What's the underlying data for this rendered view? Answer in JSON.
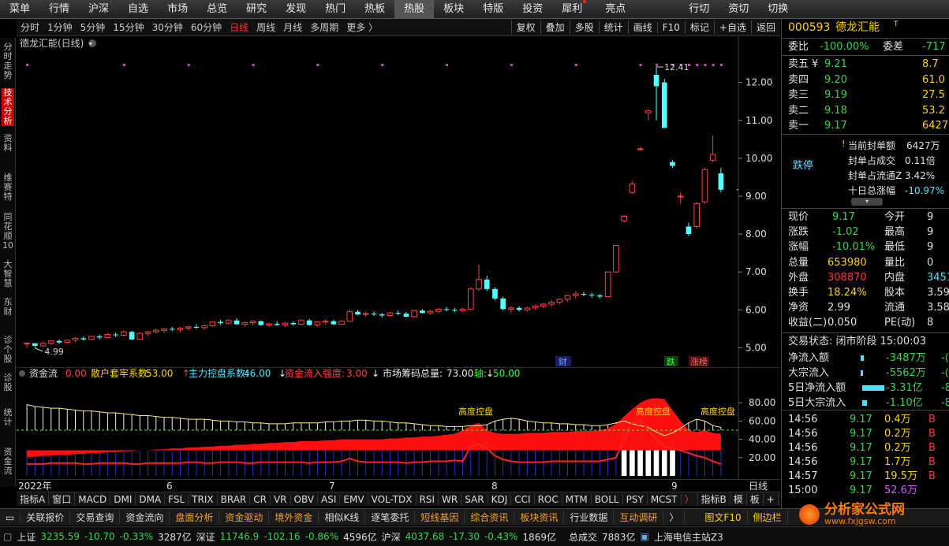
{
  "topmenu": [
    "菜单",
    "行情",
    "沪深",
    "自选",
    "市场",
    "总览",
    "研究",
    "发现",
    "热门",
    "热板",
    "热股",
    "板块",
    "特版",
    "投资",
    "犀利",
    "亮点",
    "行切",
    "资切",
    "切换"
  ],
  "topmenu_active": "热股",
  "sidebar": [
    "分时走势",
    "技术分析",
    "资料",
    "维赛特",
    "同花顺10",
    "大智慧",
    "东财",
    "诊个股",
    "诊股",
    "统计",
    "资金流"
  ],
  "sidebar_active": "技术分析",
  "periods": [
    "分时",
    "1分钟",
    "5分钟",
    "15分钟",
    "30分钟",
    "60分钟",
    "日线",
    "周线",
    "月线",
    "多周期",
    "更多 〉"
  ],
  "period_active": "日线",
  "toolbar": [
    "复权",
    "叠加",
    "多股",
    "统计",
    "画线",
    "F10",
    "标记",
    "+自选",
    "返回"
  ],
  "chart_title": "德龙汇能(日线)",
  "price_axis": [
    "12.00",
    "11.00",
    "10.00",
    "9.00",
    "8.00",
    "7.00",
    "6.00",
    "5.00"
  ],
  "high_label": "12.41",
  "low_label": "4.99",
  "markers": {
    "cai": "财",
    "die": "跌",
    "zhangbang": "涨榜"
  },
  "indicator_header": {
    "name": "资金流",
    "v0": "0.00",
    "s1_label": "散户套牢系数:",
    "s1": "53.00",
    "s2_label": "主力控盘系数:",
    "s2": "46.00",
    "s3_label": "资金流入强度:",
    "s3": "3.00",
    "s4_label": "市场筹码总量:",
    "s4": "73.00",
    "s5_label": "轴:",
    "s5": "50.00"
  },
  "ind_axis": [
    "80.00",
    "60.00",
    "40.00",
    "20.00"
  ],
  "ind_annotations": [
    "高度控盘",
    "高度控盘",
    "高度控盘"
  ],
  "xaxis": [
    "2022年",
    "6",
    "7",
    "8",
    "9"
  ],
  "xaxis_right": "日线",
  "indtabs": [
    "指标A",
    "窗口",
    "MACD",
    "DMI",
    "DMA",
    "FSL",
    "TRIX",
    "BRAR",
    "CR",
    "VR",
    "OBV",
    "ASI",
    "EMV",
    "VOL-TDX",
    "RSI",
    "WR",
    "SAR",
    "KDJ",
    "CCI",
    "ROC",
    "MTM",
    "BOLL",
    "PSY",
    "MCST",
    "〉"
  ],
  "indtabs_right": [
    "指标B",
    "模",
    "板",
    "+",
    "−"
  ],
  "funcbar": [
    "关联报价",
    "交易查询",
    "资金流向",
    "盘面分析",
    "资金驱动",
    "境外资金",
    "相似K线",
    "逐笔委托",
    "短线基因",
    "综合资讯",
    "板块资讯",
    "行业数据",
    "互动调研",
    "〉",
    "图文F10",
    "侧边栏"
  ],
  "funcbar_orange": [
    "盘面分析",
    "资金驱动",
    "境外资金",
    "短线基因",
    "综合资讯",
    "板块资讯",
    "互动调研"
  ],
  "status": {
    "sh_label": "上证",
    "sh_val": "3235.59",
    "sh_chg": "-10.70",
    "sh_pct": "-0.33%",
    "sh_amt": "3287亿",
    "sz_label": "深证",
    "sz_val": "11746.9",
    "sz_chg": "-102.16",
    "sz_pct": "-0.86%",
    "sz_amt": "4596亿",
    "hs_label": "沪深",
    "hs_val": "4037.68",
    "hs_chg": "-17.30",
    "hs_pct": "-0.43%",
    "hs_amt": "1869亿",
    "total_label": "总成交",
    "total_val": "7883亿",
    "server": "上海电信主站Z3"
  },
  "quote": {
    "code": "000593",
    "name": "德龙汇能",
    "weibi_label": "委比",
    "weibi": "-100.00%",
    "weicha_label": "委差",
    "weicha": "-717",
    "asks": [
      {
        "label": "卖五",
        "price": "9.21",
        "vol": "8.7"
      },
      {
        "label": "卖四",
        "price": "9.20",
        "vol": "61.0"
      },
      {
        "label": "卖三",
        "price": "9.19",
        "vol": "27.5"
      },
      {
        "label": "卖二",
        "price": "9.18",
        "vol": "53.2"
      },
      {
        "label": "卖一",
        "price": "9.17",
        "vol": "6427"
      }
    ],
    "limit_status": "跌停",
    "seal_info": [
      {
        "label": "当前封单额",
        "value": "6427万"
      },
      {
        "label": "封单占成交",
        "value": "0.11倍"
      },
      {
        "label": "封单占流通Z",
        "value": "3.42%"
      },
      {
        "label": "十日总涨幅",
        "value": "-10.97%"
      }
    ],
    "stats": [
      {
        "l1": "现价",
        "v1": "9.17",
        "l2": "今开",
        "v2": "9"
      },
      {
        "l1": "涨跌",
        "v1": "-1.02",
        "l2": "最高",
        "v2": "9"
      },
      {
        "l1": "涨幅",
        "v1": "-10.01%",
        "l2": "最低",
        "v2": "9"
      },
      {
        "l1": "总量",
        "v1": "653980",
        "l2": "量比",
        "v2": "0"
      },
      {
        "l1": "外盘",
        "v1": "308870",
        "l2": "内盘",
        "v2": "3451"
      },
      {
        "l1": "换手",
        "v1": "18.24%",
        "l2": "股本",
        "v2": "3.59"
      },
      {
        "l1": "净资",
        "v1": "2.99",
        "l2": "流通",
        "v2": "3.58"
      },
      {
        "l1": "收益(二)",
        "v1": "0.050",
        "l2": "PE(动)",
        "v2": "8"
      }
    ],
    "trade_status": "交易状态: 闭市阶段 15:00:03",
    "flows": [
      {
        "label": "净流入额",
        "value": "-3487万",
        "extra": "-("
      },
      {
        "label": "大宗流入",
        "value": "-5562万",
        "extra": "-("
      },
      {
        "label": "5日净流入额",
        "value": "-3.31亿",
        "extra": "-8"
      },
      {
        "label": "5日大宗流入",
        "value": "-1.10亿",
        "extra": "-8"
      }
    ],
    "ticks": [
      {
        "time": "14:56",
        "price": "9.17",
        "vol": "0.4万",
        "bs": "B"
      },
      {
        "time": "14:56",
        "price": "9.17",
        "vol": "0.2万",
        "bs": "B"
      },
      {
        "time": "14:56",
        "price": "9.17",
        "vol": "0.2万",
        "bs": "B"
      },
      {
        "time": "14:56",
        "price": "9.17",
        "vol": "1.7万",
        "bs": "B"
      },
      {
        "time": "14:57",
        "price": "9.17",
        "vol": "19.5万",
        "bs": "B"
      },
      {
        "time": "15:00",
        "price": "9.17",
        "vol": "52.6万",
        "bs": ""
      }
    ]
  },
  "logo": {
    "text": "分析家公式网",
    "url": "www.fxjgsw.com"
  },
  "chart_data": {
    "type": "candlestick",
    "candles": [
      [
        5.1,
        5.15,
        5.0,
        5.12
      ],
      [
        5.12,
        5.1,
        4.99,
        5.05
      ],
      [
        5.05,
        5.15,
        5.02,
        5.12
      ],
      [
        5.12,
        5.2,
        5.08,
        5.18
      ],
      [
        5.18,
        5.22,
        5.1,
        5.14
      ],
      [
        5.14,
        5.22,
        5.1,
        5.2
      ],
      [
        5.2,
        5.28,
        5.15,
        5.25
      ],
      [
        5.25,
        5.3,
        5.18,
        5.22
      ],
      [
        5.22,
        5.32,
        5.2,
        5.3
      ],
      [
        5.3,
        5.35,
        5.22,
        5.27
      ],
      [
        5.27,
        5.38,
        5.25,
        5.35
      ],
      [
        5.35,
        5.4,
        5.28,
        5.33
      ],
      [
        5.33,
        5.45,
        5.3,
        5.42
      ],
      [
        5.42,
        5.45,
        5.2,
        5.22
      ],
      [
        5.22,
        5.4,
        5.2,
        5.38
      ],
      [
        5.38,
        5.45,
        5.3,
        5.42
      ],
      [
        5.42,
        5.5,
        5.38,
        5.46
      ],
      [
        5.46,
        5.52,
        5.4,
        5.5
      ],
      [
        5.5,
        5.55,
        5.44,
        5.48
      ],
      [
        5.48,
        5.55,
        5.42,
        5.52
      ],
      [
        5.52,
        5.58,
        5.46,
        5.55
      ],
      [
        5.55,
        5.62,
        5.5,
        5.53
      ],
      [
        5.53,
        5.6,
        5.48,
        5.58
      ],
      [
        5.58,
        5.7,
        5.55,
        5.68
      ],
      [
        5.68,
        5.74,
        5.6,
        5.65
      ],
      [
        5.65,
        5.75,
        5.62,
        5.72
      ],
      [
        5.72,
        5.78,
        5.6,
        5.62
      ],
      [
        5.62,
        5.7,
        5.55,
        5.66
      ],
      [
        5.66,
        5.72,
        5.6,
        5.7
      ],
      [
        5.7,
        5.72,
        5.58,
        5.6
      ],
      [
        5.6,
        5.66,
        5.55,
        5.63
      ],
      [
        5.63,
        5.7,
        5.58,
        5.6
      ],
      [
        5.6,
        5.68,
        5.55,
        5.65
      ],
      [
        5.65,
        5.7,
        5.58,
        5.62
      ],
      [
        5.62,
        5.75,
        5.6,
        5.72
      ],
      [
        5.72,
        5.76,
        5.58,
        5.6
      ],
      [
        5.6,
        5.7,
        5.56,
        5.68
      ],
      [
        5.68,
        5.75,
        5.62,
        5.7
      ],
      [
        5.7,
        5.74,
        5.6,
        5.62
      ],
      [
        5.62,
        5.72,
        5.6,
        5.7
      ],
      [
        5.7,
        6.02,
        5.68,
        5.95
      ],
      [
        5.95,
        6.0,
        5.85,
        5.88
      ],
      [
        5.88,
        5.95,
        5.82,
        5.9
      ],
      [
        5.9,
        5.95,
        5.84,
        5.88
      ],
      [
        5.88,
        5.92,
        5.8,
        5.85
      ],
      [
        5.85,
        5.95,
        5.82,
        5.92
      ],
      [
        5.92,
        5.98,
        5.86,
        5.9
      ],
      [
        5.9,
        5.95,
        5.8,
        5.82
      ],
      [
        5.82,
        6.0,
        5.8,
        5.98
      ],
      [
        5.98,
        6.02,
        5.9,
        5.92
      ],
      [
        5.92,
        6.0,
        5.88,
        5.96
      ],
      [
        5.96,
        6.05,
        5.92,
        6.02
      ],
      [
        6.02,
        6.08,
        5.96,
        6.0
      ],
      [
        6.0,
        6.05,
        5.94,
        5.98
      ],
      [
        5.98,
        6.05,
        5.94,
        6.02
      ],
      [
        6.02,
        6.6,
        6.0,
        6.55
      ],
      [
        6.55,
        7.2,
        6.5,
        6.8
      ],
      [
        6.8,
        6.9,
        6.5,
        6.55
      ],
      [
        6.55,
        6.6,
        6.25,
        6.3
      ],
      [
        6.3,
        6.35,
        5.98,
        6.02
      ],
      [
        6.02,
        6.1,
        5.92,
        6.05
      ],
      [
        6.05,
        6.1,
        5.96,
        6.0
      ],
      [
        6.0,
        6.08,
        5.95,
        6.05
      ],
      [
        6.05,
        6.12,
        6.0,
        6.1
      ],
      [
        6.1,
        6.18,
        6.05,
        6.15
      ],
      [
        6.15,
        6.25,
        6.08,
        6.2
      ],
      [
        6.2,
        6.3,
        6.15,
        6.28
      ],
      [
        6.28,
        6.4,
        6.22,
        6.38
      ],
      [
        6.38,
        6.5,
        6.3,
        6.42
      ],
      [
        6.42,
        6.48,
        6.36,
        6.4
      ],
      [
        6.4,
        6.45,
        6.32,
        6.38
      ],
      [
        6.38,
        6.42,
        6.3,
        6.35
      ],
      [
        6.35,
        7.0,
        6.33,
        7.0
      ],
      [
        7.0,
        7.7,
        6.98,
        7.7
      ],
      [
        8.35,
        8.5,
        8.3,
        8.47
      ],
      [
        9.1,
        9.4,
        9.05,
        9.32
      ],
      [
        10.25,
        10.3,
        10.2,
        10.25
      ],
      [
        11.2,
        11.3,
        11.0,
        11.25
      ],
      [
        12.2,
        12.41,
        11.0,
        11.9
      ],
      [
        12.0,
        12.1,
        10.8,
        10.8
      ],
      [
        9.9,
        9.95,
        9.75,
        9.8
      ],
      [
        9.0,
        9.1,
        8.8,
        9.0
      ],
      [
        8.2,
        8.3,
        7.95,
        8.0
      ],
      [
        8.2,
        8.85,
        8.15,
        8.8
      ],
      [
        8.85,
        9.75,
        8.8,
        9.7
      ],
      [
        9.95,
        10.6,
        9.9,
        10.1
      ],
      [
        9.6,
        9.75,
        9.1,
        9.17
      ]
    ],
    "ylim": [
      4.8,
      12.7
    ],
    "ind_series": [
      {
        "name": "散户套牢系数",
        "values": [
          78,
          76,
          75,
          74,
          74,
          73,
          72,
          71,
          71,
          70,
          69,
          69,
          68,
          67,
          66,
          66,
          65,
          64,
          64,
          63,
          62,
          62,
          62,
          61,
          60,
          60,
          59,
          59,
          58,
          58,
          57,
          57,
          57,
          58,
          58,
          58,
          58,
          59,
          59,
          60,
          60,
          61,
          61,
          60,
          60,
          59,
          58,
          58,
          57,
          56,
          55,
          55,
          54,
          54,
          54,
          55,
          55,
          56,
          60,
          62,
          63,
          62,
          60,
          59,
          58,
          58,
          57,
          57,
          56,
          56,
          55,
          55,
          56,
          58,
          60,
          57,
          55,
          53,
          48,
          44,
          47,
          52,
          58,
          62,
          60,
          55,
          53
        ]
      },
      {
        "name": "主力控盘系数",
        "values": [
          20,
          21,
          22,
          22,
          23,
          23,
          24,
          24,
          25,
          25,
          26,
          26,
          27,
          27,
          28,
          28,
          29,
          29,
          30,
          30,
          31,
          31,
          32,
          32,
          33,
          33,
          34,
          34,
          35,
          35,
          36,
          36,
          37,
          37,
          38,
          38,
          38,
          39,
          39,
          40,
          40,
          40,
          40,
          40,
          40,
          41,
          41,
          42,
          42,
          43,
          43,
          44,
          45,
          46,
          50,
          55,
          58,
          50,
          47,
          46,
          46,
          46,
          47,
          47,
          47,
          48,
          48,
          48,
          49,
          49,
          49,
          50,
          52,
          57,
          65,
          73,
          80,
          84,
          85,
          84,
          72,
          60,
          50,
          48,
          50,
          47,
          46
        ]
      },
      {
        "name": "资金流入强度",
        "values": [
          3,
          3,
          3,
          4,
          4,
          4,
          4,
          3,
          3,
          4,
          4,
          4,
          4,
          3,
          3,
          4,
          4,
          4,
          4,
          4,
          5,
          5,
          4,
          4,
          5,
          5,
          5,
          4,
          4,
          5,
          5,
          5,
          5,
          5,
          5,
          4,
          5,
          5,
          5,
          6,
          9,
          6,
          5,
          5,
          5,
          5,
          5,
          4,
          5,
          5,
          6,
          6,
          6,
          7,
          6,
          22,
          25,
          20,
          12,
          8,
          6,
          5,
          5,
          5,
          5,
          6,
          6,
          6,
          6,
          6,
          6,
          6,
          8,
          10,
          30,
          48,
          50,
          40,
          30,
          22,
          20,
          18,
          15,
          12,
          10,
          6,
          3
        ]
      }
    ],
    "ind_ylim": [
      0,
      100
    ]
  }
}
